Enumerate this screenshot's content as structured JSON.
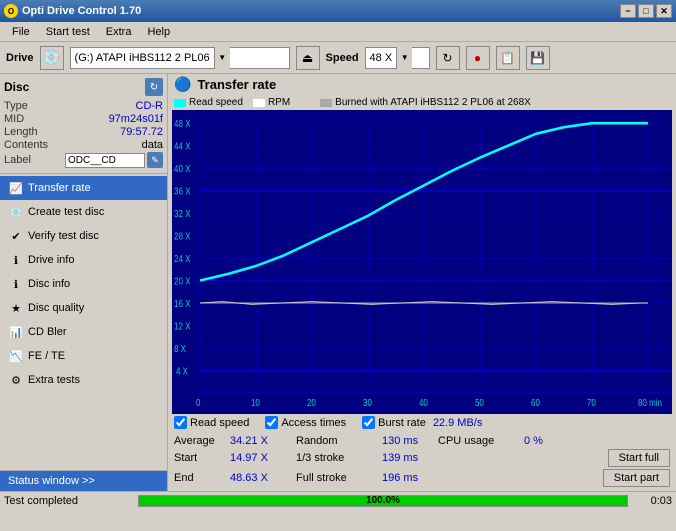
{
  "titlebar": {
    "title": "Opti Drive Control 1.70",
    "minimize": "−",
    "maximize": "□",
    "close": "✕"
  },
  "menu": {
    "items": [
      "File",
      "Start test",
      "Extra",
      "Help"
    ]
  },
  "drive": {
    "label": "Drive",
    "value": "(G:)  ATAPI iHBS112  2 PL06",
    "speed_label": "Speed",
    "speed_value": "48 X"
  },
  "disc": {
    "title": "Disc",
    "type_label": "Type",
    "type_value": "CD-R",
    "mid_label": "MID",
    "mid_value": "97m24s01f",
    "length_label": "Length",
    "length_value": "79:57.72",
    "contents_label": "Contents",
    "contents_value": "data",
    "label_label": "Label",
    "label_value": "ODC__CD"
  },
  "nav": {
    "items": [
      {
        "id": "transfer-rate",
        "label": "Transfer rate",
        "active": true
      },
      {
        "id": "create-test-disc",
        "label": "Create test disc",
        "active": false
      },
      {
        "id": "verify-test-disc",
        "label": "Verify test disc",
        "active": false
      },
      {
        "id": "drive-info",
        "label": "Drive info",
        "active": false
      },
      {
        "id": "disc-info",
        "label": "Disc info",
        "active": false
      },
      {
        "id": "disc-quality",
        "label": "Disc quality",
        "active": false
      },
      {
        "id": "cd-bler",
        "label": "CD Bler",
        "active": false
      },
      {
        "id": "fe-te",
        "label": "FE / TE",
        "active": false
      },
      {
        "id": "extra-tests",
        "label": "Extra tests",
        "active": false
      }
    ],
    "status_window": "Status window >>"
  },
  "chart": {
    "title": "Transfer rate",
    "legend": {
      "read_speed_label": "Read speed",
      "rpm_label": "RPM",
      "burned_label": "Burned with ATAPI iHBS112  2 PL06 at 268X"
    },
    "y_labels": [
      "48 X",
      "44 X",
      "40 X",
      "36 X",
      "32 X",
      "28 X",
      "24 X",
      "20 X",
      "16 X",
      "12 X",
      "8 X",
      "4 X"
    ],
    "x_labels": [
      "0",
      "10",
      "20",
      "30",
      "40",
      "50",
      "60",
      "70",
      "80 min"
    ],
    "checkboxes": {
      "read_speed": "Read speed",
      "access_times": "Access times",
      "burst_rate": "Burst rate",
      "burst_rate_value": "22.9 MB/s"
    }
  },
  "stats": {
    "average_label": "Average",
    "average_value": "34.21 X",
    "random_label": "Random",
    "random_value": "130 ms",
    "cpu_label": "CPU usage",
    "cpu_value": "0 %",
    "start_label": "Start",
    "start_value": "14.97 X",
    "stroke1_label": "1/3 stroke",
    "stroke1_value": "139 ms",
    "btn_start_full": "Start full",
    "end_label": "End",
    "end_value": "48.63 X",
    "stroke2_label": "Full stroke",
    "stroke2_value": "196 ms",
    "btn_start_part": "Start part"
  },
  "statusbar": {
    "text": "Test completed",
    "progress": "100.0%",
    "time": "0:03"
  }
}
